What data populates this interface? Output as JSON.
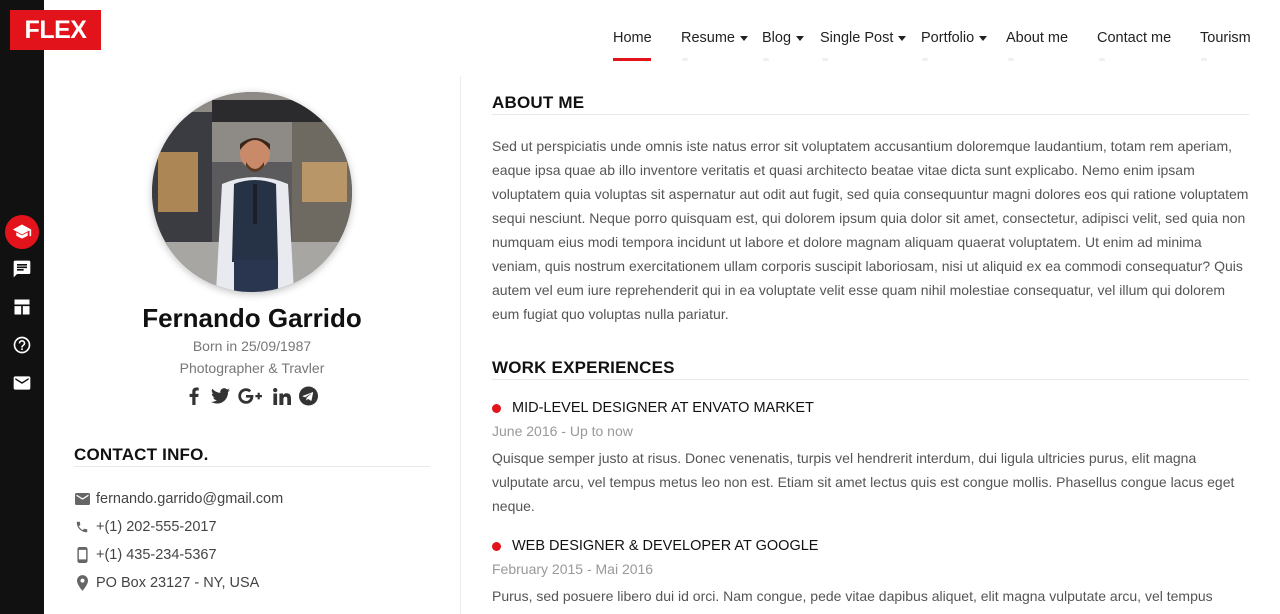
{
  "logo": "FLEX",
  "nav": {
    "items": [
      {
        "label": "Home",
        "dropdown": false,
        "active": true
      },
      {
        "label": "Resume",
        "dropdown": true
      },
      {
        "label": "Blog",
        "dropdown": true
      },
      {
        "label": "Single Post",
        "dropdown": true
      },
      {
        "label": "Portfolio",
        "dropdown": true
      },
      {
        "label": "About me",
        "dropdown": false
      },
      {
        "label": "Contact me",
        "dropdown": false
      },
      {
        "label": "Tourism",
        "dropdown": false
      }
    ]
  },
  "rail": {
    "icons": [
      "graduation-cap-icon",
      "comment-icon",
      "dashboard-icon",
      "help-icon",
      "mail-icon"
    ],
    "active_index": 0
  },
  "profile": {
    "name": "Fernando Garrido",
    "born": "Born in 25/09/1987",
    "role": "Photographer & Travler",
    "socials": [
      "facebook-icon",
      "twitter-icon",
      "google-plus-icon",
      "linkedin-icon",
      "telegram-icon"
    ]
  },
  "contact": {
    "heading": "CONTACT INFO.",
    "items": [
      {
        "icon": "mail-icon",
        "text": "fernando.garrido@gmail.com"
      },
      {
        "icon": "phone-icon",
        "text": "+(1) 202-555-2017"
      },
      {
        "icon": "mobile-icon",
        "text": "+(1) 435-234-5367"
      },
      {
        "icon": "location-icon",
        "text": "PO Box 23127 - NY, USA"
      }
    ]
  },
  "about": {
    "heading": "ABOUT ME",
    "text": "Sed ut perspiciatis unde omnis iste natus error sit voluptatem accusantium doloremque laudantium, totam rem aperiam, eaque ipsa quae ab illo inventore veritatis et quasi architecto beatae vitae dicta sunt explicabo. Nemo enim ipsam voluptatem quia voluptas sit aspernatur aut odit aut fugit, sed quia consequuntur magni dolores eos qui ratione voluptatem sequi nesciunt. Neque porro quisquam est, qui dolorem ipsum quia dolor sit amet, consectetur, adipisci velit, sed quia non numquam eius modi tempora incidunt ut labore et dolore magnam aliquam quaerat voluptatem. Ut enim ad minima veniam, quis nostrum exercitationem ullam corporis suscipit laboriosam, nisi ut aliquid ex ea commodi consequatur? Quis autem vel eum iure reprehenderit qui in ea voluptate velit esse quam nihil molestiae consequatur, vel illum qui dolorem eum fugiat quo voluptas nulla pariatur."
  },
  "work": {
    "heading": "WORK EXPERIENCES",
    "jobs": [
      {
        "title": "MID-LEVEL DESIGNER AT ENVATO MARKET",
        "date": "June 2016 - Up to now",
        "text": "Quisque semper justo at risus. Donec venenatis, turpis vel hendrerit interdum, dui ligula ultricies purus, elit magna vulputate arcu, vel tempus metus leo non est. Etiam sit amet lectus quis est congue mollis. Phasellus congue lacus eget neque."
      },
      {
        "title": "WEB DESIGNER & DEVELOPER AT GOOGLE",
        "date": "February 2015 - Mai 2016",
        "text": "Purus, sed posuere libero dui id orci. Nam congue, pede vitae dapibus aliquet, elit magna vulputate arcu, vel tempus"
      }
    ]
  },
  "colors": {
    "accent": "#e3131b",
    "rail": "#111111"
  }
}
